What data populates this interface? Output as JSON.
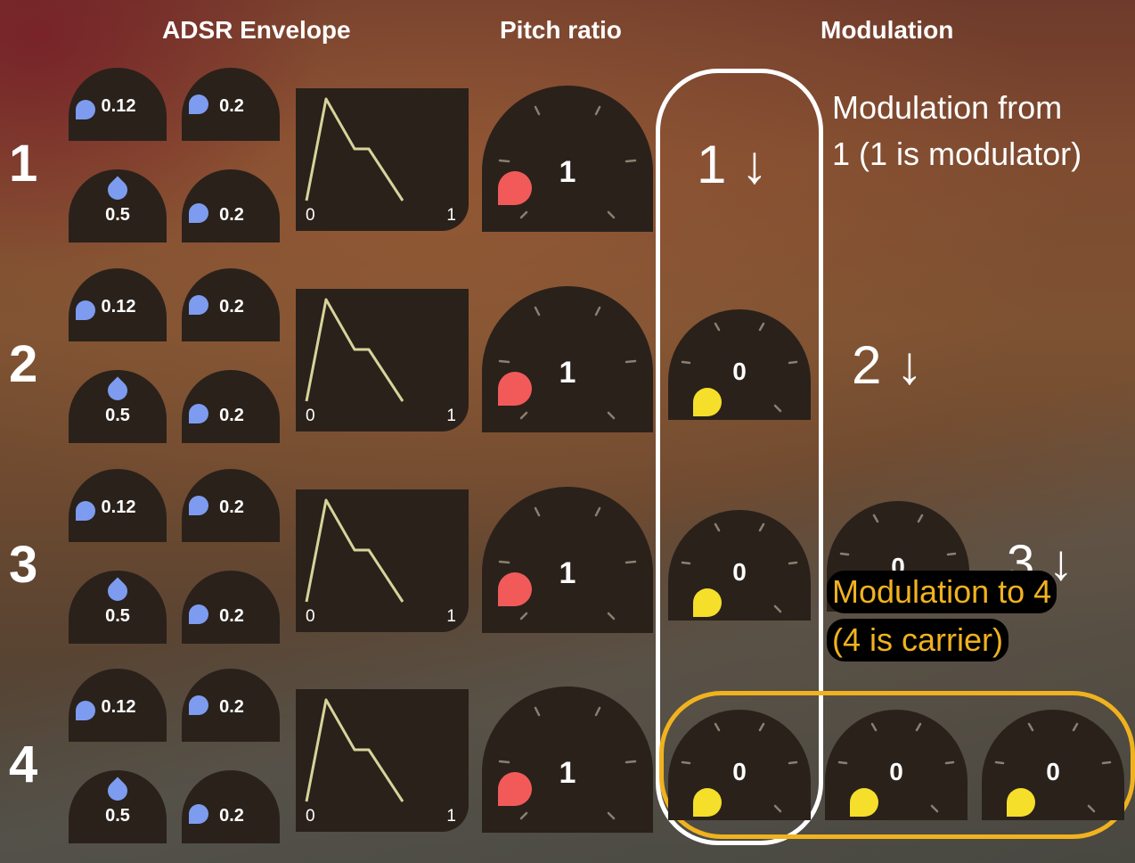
{
  "headers": {
    "adsr": "ADSR Envelope",
    "pitch": "Pitch ratio",
    "modulation": "Modulation"
  },
  "rows": [
    {
      "num": "1",
      "attack": "0.12",
      "decay": "0.2",
      "sustain": "0.5",
      "release": "0.2",
      "env_start": "0",
      "env_end": "1",
      "pitch": "1"
    },
    {
      "num": "2",
      "attack": "0.12",
      "decay": "0.2",
      "sustain": "0.5",
      "release": "0.2",
      "env_start": "0",
      "env_end": "1",
      "pitch": "1"
    },
    {
      "num": "3",
      "attack": "0.12",
      "decay": "0.2",
      "sustain": "0.5",
      "release": "0.2",
      "env_start": "0",
      "env_end": "1",
      "pitch": "1"
    },
    {
      "num": "4",
      "attack": "0.12",
      "decay": "0.2",
      "sustain": "0.5",
      "release": "0.2",
      "env_start": "0",
      "env_end": "1",
      "pitch": "1"
    }
  ],
  "modulation": {
    "row1_label": "1 ↓",
    "row2_label": "2 ↓",
    "row3_label": "3 ↓",
    "knob_r2c1": "0",
    "knob_r3c1": "0",
    "knob_r3c2": "0",
    "knob_r4c1": "0",
    "knob_r4c2": "0",
    "knob_r4c3": "0"
  },
  "annotations": {
    "from_line1": "Modulation from",
    "from_line2": "1 (1 is modulator)",
    "to_line1": "Modulation to 4",
    "to_line2": "(4 is carrier)"
  },
  "colors": {
    "attack_drop": "#7d9cf0",
    "pitch_indicator": "#f25a5a",
    "mod_indicator": "#f5df2a",
    "carrier_frame": "#f0b21e",
    "envelope_line": "#d8d39a"
  },
  "icons": {
    "arrow": "down-arrow-icon",
    "knob_indicator": "droplet-icon"
  }
}
